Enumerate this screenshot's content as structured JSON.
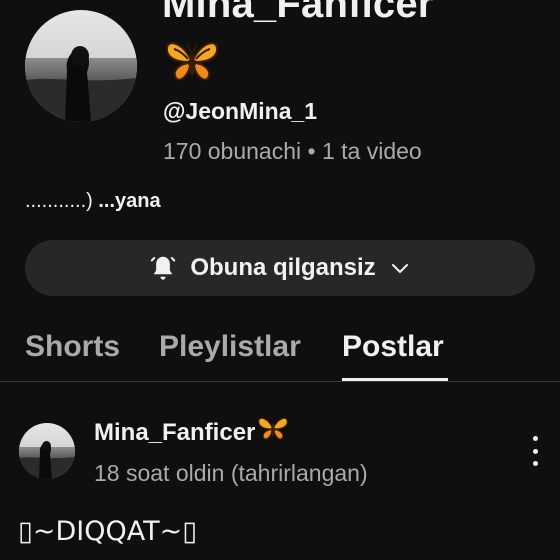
{
  "header": {
    "channel_name": "Mina_Fanficer",
    "handle": "@JeonMina_1",
    "meta": "170 obunachi • 1 ta video",
    "description_dots": "...........) ",
    "description_more": "...yana",
    "emoji_icon": "butterfly-icon"
  },
  "subscribe": {
    "label": "Obuna qilgansiz",
    "bell_icon": "bell-icon",
    "chevron_icon": "chevron-down-icon"
  },
  "tabs": [
    {
      "label": "Shorts",
      "active": false
    },
    {
      "label": "Pleylistlar",
      "active": false
    },
    {
      "label": "Postlar",
      "active": true
    }
  ],
  "post": {
    "author": "Mina_Fanficer",
    "time": "18 soat oldin (tahrirlangan)",
    "text": "▯~DIQQAT~▯"
  },
  "colors": {
    "background": "#0f0f0f",
    "button_bg": "#272727",
    "text_primary": "#f1f1f1",
    "text_secondary": "#aaaaaa",
    "butterfly": "#f5a623"
  }
}
